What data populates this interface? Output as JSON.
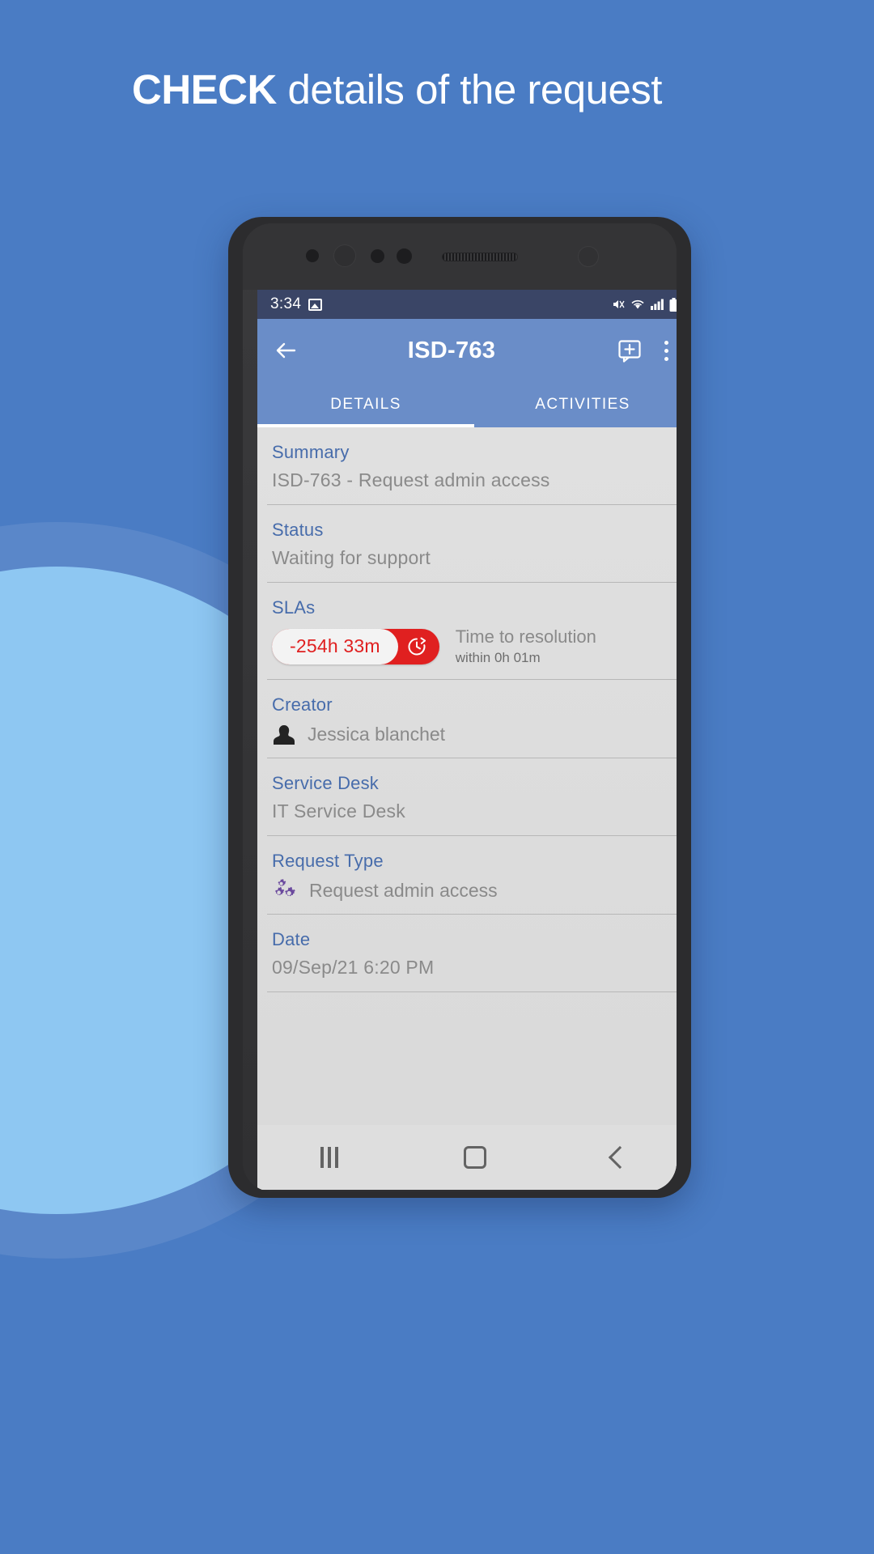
{
  "headline": {
    "bold": "CHECK",
    "rest": " details of the request"
  },
  "colors": {
    "background": "#4a7cc4",
    "circle": "#8ec7f2",
    "appbar": "#6a8dc8",
    "statusbar": "#3a4566",
    "label": "#476cab",
    "value": "#8a8a8a",
    "sla_red": "#e02020"
  },
  "phone": {
    "statusbar": {
      "time": "3:34",
      "left_icons": [
        "image-icon"
      ],
      "right_icons": [
        "mute-icon",
        "wifi-icon",
        "signal-icon",
        "battery-icon"
      ]
    },
    "appbar": {
      "back_icon": "back-arrow-icon",
      "title": "ISD-763",
      "add_comment_icon": "add-comment-icon",
      "more_icon": "more-vertical-icon"
    },
    "tabs": [
      {
        "label": "DETAILS",
        "active": true
      },
      {
        "label": "ACTIVITIES",
        "active": false
      }
    ],
    "fields": [
      {
        "label": "Summary",
        "value": "ISD-763 - Request admin access",
        "icon": null
      },
      {
        "label": "Status",
        "value": "Waiting for support",
        "icon": null
      },
      {
        "label": "SLAs",
        "value": null,
        "icon": null,
        "sla": {
          "badge": "-254h 33m",
          "badge_icon": "clock-refresh-icon",
          "title": "Time to resolution",
          "subtitle": "within 0h 01m"
        }
      },
      {
        "label": "Creator",
        "value": "Jessica blanchet",
        "icon": "person-avatar-icon"
      },
      {
        "label": "Service Desk",
        "value": "IT Service Desk",
        "icon": null
      },
      {
        "label": "Request Type",
        "value": "Request admin access",
        "icon": "gears-icon"
      },
      {
        "label": "Date",
        "value": "09/Sep/21 6:20 PM",
        "icon": null
      }
    ],
    "navbar": {
      "recent_label": "recent-apps",
      "home_label": "home",
      "back_label": "back"
    }
  }
}
